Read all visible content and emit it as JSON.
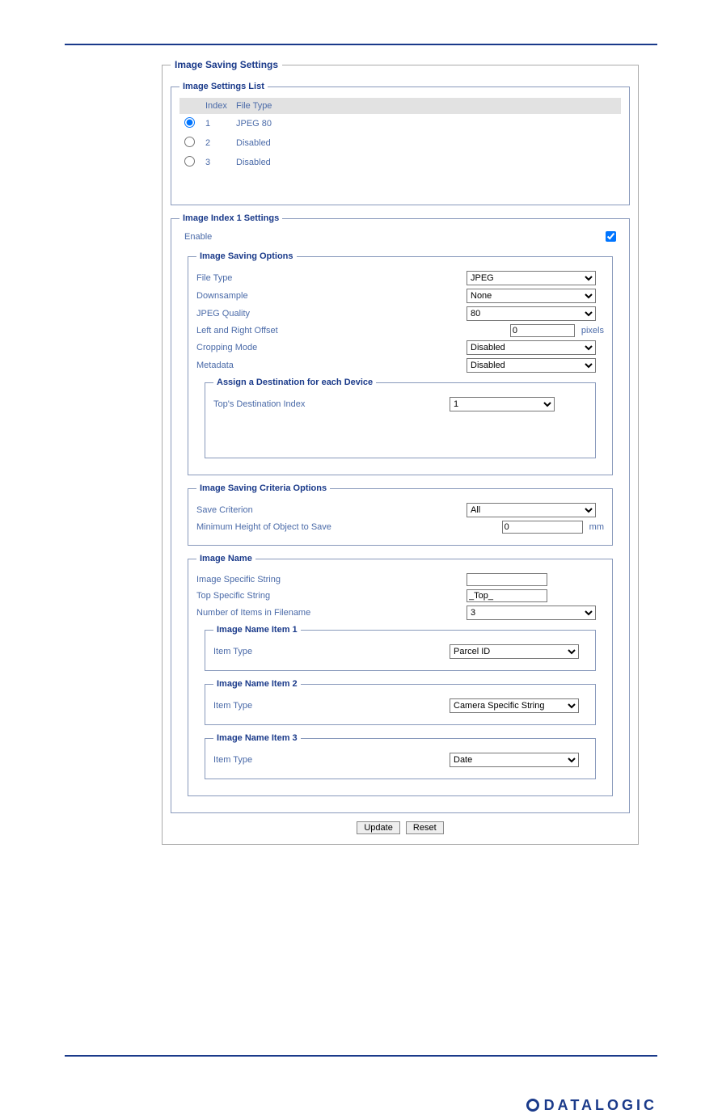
{
  "titles": {
    "main": "Image Saving Settings",
    "list": "Image Settings List",
    "index1": "Image Index 1 Settings",
    "saving_options": "Image Saving Options",
    "assign_dest": "Assign a Destination for each Device",
    "criteria": "Image Saving Criteria Options",
    "image_name": "Image Name",
    "item1": "Image Name Item 1",
    "item2": "Image Name Item 2",
    "item3": "Image Name Item 3"
  },
  "list": {
    "header": {
      "index": "Index",
      "filetype": "File Type"
    },
    "rows": [
      {
        "index": "1",
        "filetype": "JPEG 80",
        "selected": true
      },
      {
        "index": "2",
        "filetype": "Disabled",
        "selected": false
      },
      {
        "index": "3",
        "filetype": "Disabled",
        "selected": false
      }
    ]
  },
  "enable": {
    "label": "Enable",
    "checked": true
  },
  "saving_options": {
    "file_type": {
      "label": "File Type",
      "value": "JPEG"
    },
    "downsample": {
      "label": "Downsample",
      "value": "None"
    },
    "jpeg_quality": {
      "label": "JPEG Quality",
      "value": "80"
    },
    "offset": {
      "label": "Left and Right Offset",
      "value": "0",
      "unit": "pixels"
    },
    "cropping": {
      "label": "Cropping Mode",
      "value": "Disabled"
    },
    "metadata": {
      "label": "Metadata",
      "value": "Disabled"
    },
    "dest_index": {
      "label": "Top's Destination Index",
      "value": "1"
    }
  },
  "criteria": {
    "save_criterion": {
      "label": "Save Criterion",
      "value": "All"
    },
    "min_height": {
      "label": "Minimum Height of Object to Save",
      "value": "0",
      "unit": "mm"
    }
  },
  "image_name": {
    "image_specific": {
      "label": "Image Specific String",
      "value": ""
    },
    "top_specific": {
      "label": "Top Specific String",
      "value": "_Top_"
    },
    "num_items": {
      "label": "Number of Items in Filename",
      "value": "3"
    },
    "item1": {
      "label": "Item Type",
      "value": "Parcel ID"
    },
    "item2": {
      "label": "Item Type",
      "value": "Camera Specific String"
    },
    "item3": {
      "label": "Item Type",
      "value": "Date"
    }
  },
  "buttons": {
    "update": "Update",
    "reset": "Reset"
  },
  "brand": "DATALOGIC"
}
